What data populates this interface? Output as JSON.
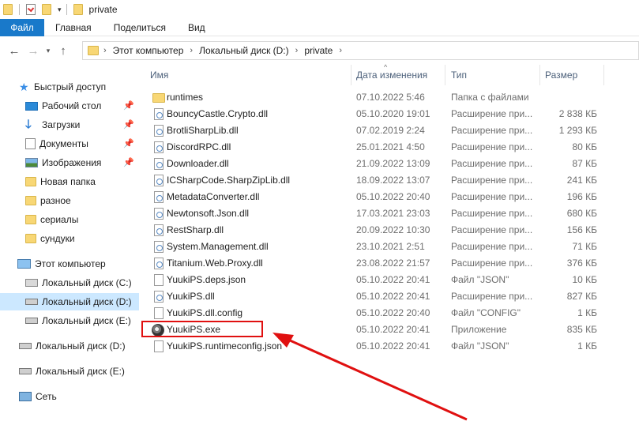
{
  "window": {
    "title": "private"
  },
  "ribbon": {
    "tabs": [
      "Файл",
      "Главная",
      "Поделиться",
      "Вид"
    ]
  },
  "address": {
    "crumbs": [
      "Этот компьютер",
      "Локальный диск (D:)",
      "private"
    ]
  },
  "sidebar": {
    "quick_access": "Быстрый доступ",
    "pinned": [
      "Рабочий стол",
      "Загрузки",
      "Документы",
      "Изображения"
    ],
    "folders": [
      "Новая папка",
      "разное",
      "сериалы",
      "сундуки"
    ],
    "this_pc": "Этот компьютер",
    "pc_drives": [
      "Локальный диск (C:)",
      "Локальный диск (D:)",
      "Локальный диск (E:)"
    ],
    "drives": [
      "Локальный диск (D:)",
      "Локальный диск (E:)"
    ],
    "network": "Сеть"
  },
  "columns": {
    "name": "Имя",
    "date": "Дата изменения",
    "type": "Тип",
    "size": "Размер"
  },
  "files": [
    {
      "name": "runtimes",
      "date": "07.10.2022 5:46",
      "type": "Папка с файлами",
      "size": "",
      "icon": "folder"
    },
    {
      "name": "BouncyCastle.Crypto.dll",
      "date": "05.10.2020 19:01",
      "type": "Расширение при...",
      "size": "2 838 КБ",
      "icon": "dll"
    },
    {
      "name": "BrotliSharpLib.dll",
      "date": "07.02.2019 2:24",
      "type": "Расширение при...",
      "size": "1 293 КБ",
      "icon": "dll"
    },
    {
      "name": "DiscordRPC.dll",
      "date": "25.01.2021 4:50",
      "type": "Расширение при...",
      "size": "80 КБ",
      "icon": "dll"
    },
    {
      "name": "Downloader.dll",
      "date": "21.09.2022 13:09",
      "type": "Расширение при...",
      "size": "87 КБ",
      "icon": "dll"
    },
    {
      "name": "ICSharpCode.SharpZipLib.dll",
      "date": "18.09.2022 13:07",
      "type": "Расширение при...",
      "size": "241 КБ",
      "icon": "dll"
    },
    {
      "name": "MetadataConverter.dll",
      "date": "05.10.2022 20:40",
      "type": "Расширение при...",
      "size": "196 КБ",
      "icon": "dll"
    },
    {
      "name": "Newtonsoft.Json.dll",
      "date": "17.03.2021 23:03",
      "type": "Расширение при...",
      "size": "680 КБ",
      "icon": "dll"
    },
    {
      "name": "RestSharp.dll",
      "date": "20.09.2022 10:30",
      "type": "Расширение при...",
      "size": "156 КБ",
      "icon": "dll"
    },
    {
      "name": "System.Management.dll",
      "date": "23.10.2021 2:51",
      "type": "Расширение при...",
      "size": "71 КБ",
      "icon": "dll"
    },
    {
      "name": "Titanium.Web.Proxy.dll",
      "date": "23.08.2022 21:57",
      "type": "Расширение при...",
      "size": "376 КБ",
      "icon": "dll"
    },
    {
      "name": "YuukiPS.deps.json",
      "date": "05.10.2022 20:41",
      "type": "Файл \"JSON\"",
      "size": "10 КБ",
      "icon": "doc"
    },
    {
      "name": "YuukiPS.dll",
      "date": "05.10.2022 20:41",
      "type": "Расширение при...",
      "size": "827 КБ",
      "icon": "dll"
    },
    {
      "name": "YuukiPS.dll.config",
      "date": "05.10.2022 20:40",
      "type": "Файл \"CONFIG\"",
      "size": "1 КБ",
      "icon": "doc"
    },
    {
      "name": "YuukiPS.exe",
      "date": "05.10.2022 20:41",
      "type": "Приложение",
      "size": "835 КБ",
      "icon": "exe"
    },
    {
      "name": "YuukiPS.runtimeconfig.json",
      "date": "05.10.2022 20:41",
      "type": "Файл \"JSON\"",
      "size": "1 КБ",
      "icon": "doc"
    }
  ],
  "colors": {
    "accent": "#1979ca",
    "selected": "#cce8ff",
    "annotation": "#e01010"
  }
}
